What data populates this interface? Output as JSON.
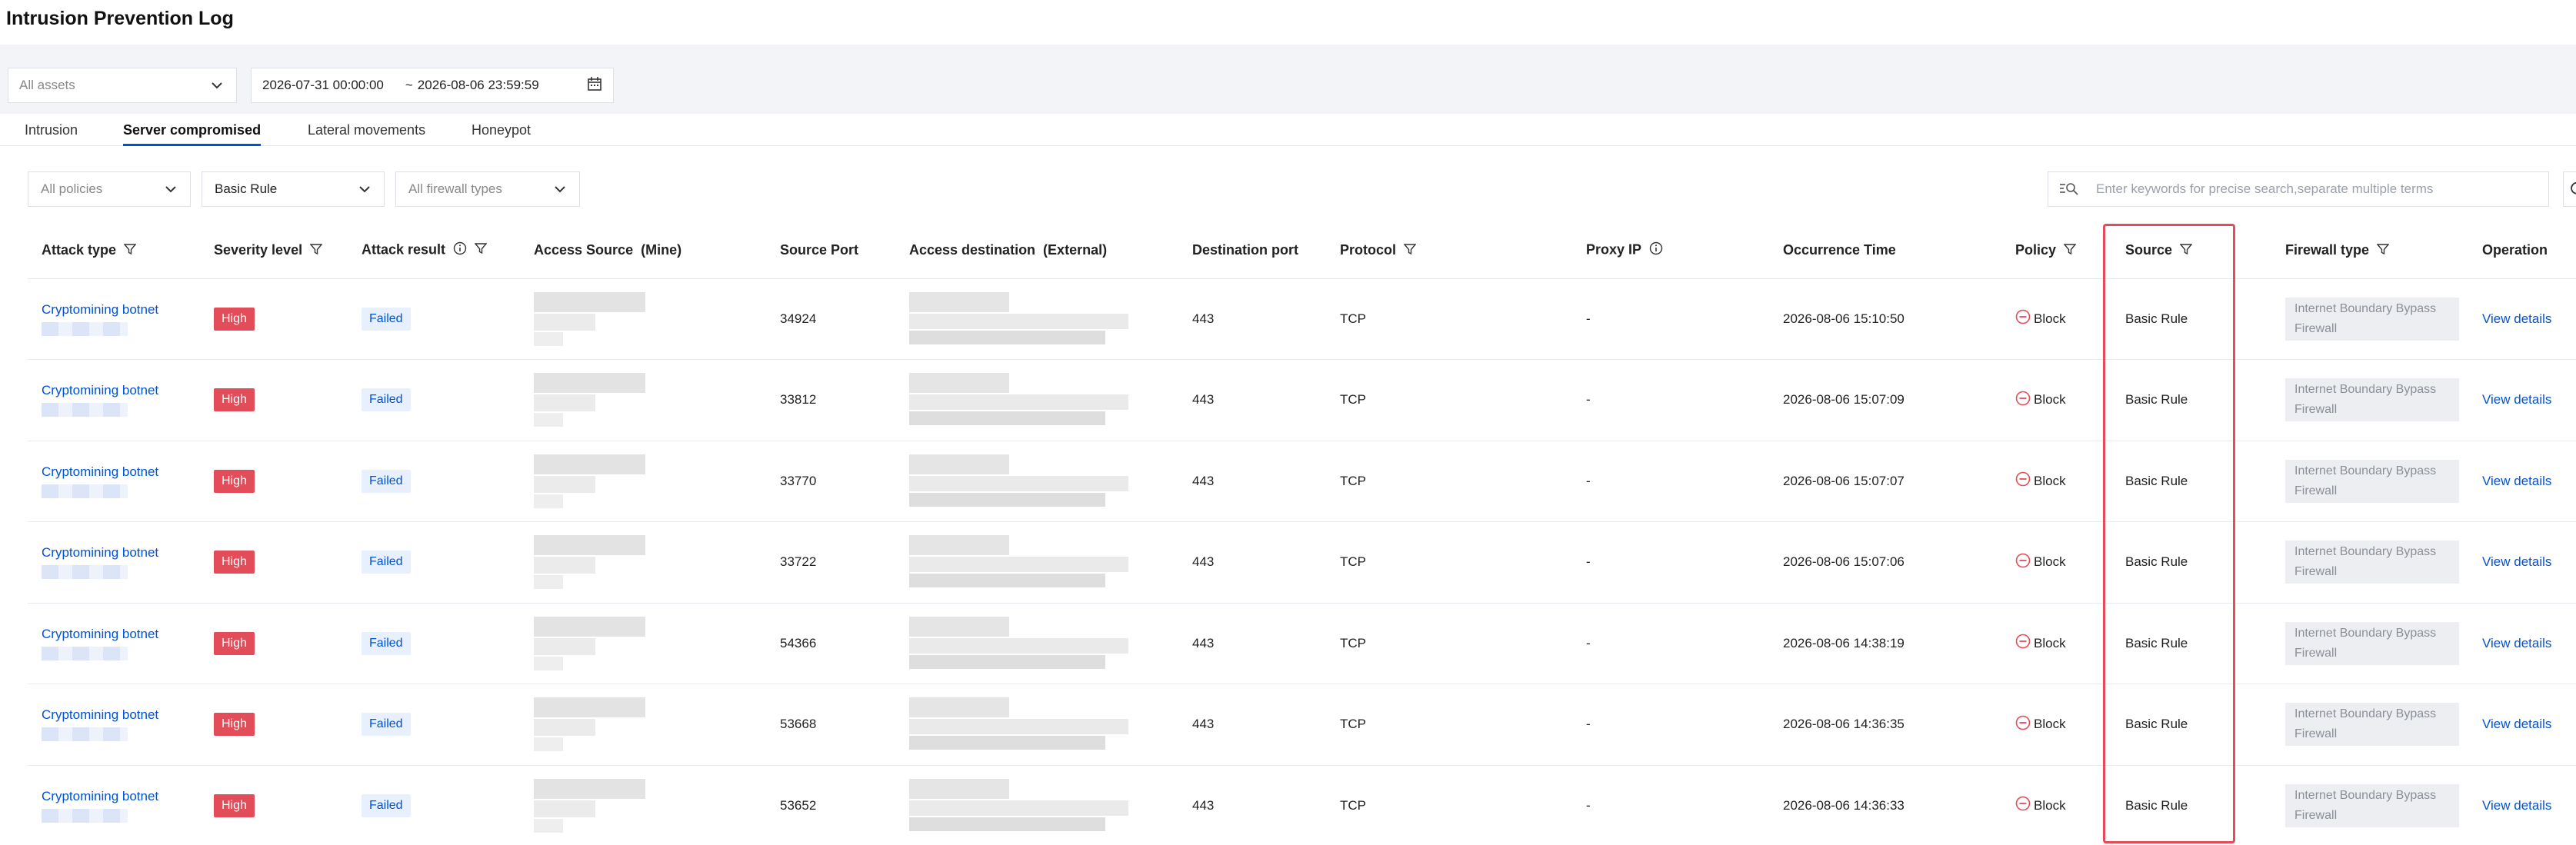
{
  "page": {
    "title": "Intrusion Prevention Log"
  },
  "toolbar": {
    "asset_select": "All assets",
    "date_start": "2026-07-31 00:00:00",
    "date_sep": "~",
    "date_end": "2026-08-06 23:59:59"
  },
  "tabs": [
    "Intrusion",
    "Server compromised",
    "Lateral movements",
    "Honeypot"
  ],
  "active_tab": "Server compromised",
  "filters": {
    "policy": "All policies",
    "rule": "Basic Rule",
    "firewall": "All firewall types",
    "search_placeholder": "Enter keywords for precise search,separate multiple terms"
  },
  "table": {
    "columns": [
      "Attack type",
      "Severity level",
      "Attack result",
      "Access Source  (Mine)",
      "Source Port",
      "Access destination  (External)",
      "Destination port",
      "Protocol",
      "Proxy IP",
      "Occurrence Time",
      "Policy",
      "Source",
      "Firewall type",
      "Operation"
    ],
    "rows": [
      {
        "attack_type": "Cryptomining botnet",
        "severity": "High",
        "result": "Failed",
        "source_port": "34924",
        "dest_port": "443",
        "protocol": "TCP",
        "proxy_ip": "-",
        "time": "2026-08-06 15:10:50",
        "policy": "Block",
        "source": "Basic Rule",
        "firewall_type": "Internet Boundary Bypass Firewall",
        "operation": "View details"
      },
      {
        "attack_type": "Cryptomining botnet",
        "severity": "High",
        "result": "Failed",
        "source_port": "33812",
        "dest_port": "443",
        "protocol": "TCP",
        "proxy_ip": "-",
        "time": "2026-08-06 15:07:09",
        "policy": "Block",
        "source": "Basic Rule",
        "firewall_type": "Internet Boundary Bypass Firewall",
        "operation": "View details"
      },
      {
        "attack_type": "Cryptomining botnet",
        "severity": "High",
        "result": "Failed",
        "source_port": "33770",
        "dest_port": "443",
        "protocol": "TCP",
        "proxy_ip": "-",
        "time": "2026-08-06 15:07:07",
        "policy": "Block",
        "source": "Basic Rule",
        "firewall_type": "Internet Boundary Bypass Firewall",
        "operation": "View details"
      },
      {
        "attack_type": "Cryptomining botnet",
        "severity": "High",
        "result": "Failed",
        "source_port": "33722",
        "dest_port": "443",
        "protocol": "TCP",
        "proxy_ip": "-",
        "time": "2026-08-06 15:07:06",
        "policy": "Block",
        "source": "Basic Rule",
        "firewall_type": "Internet Boundary Bypass Firewall",
        "operation": "View details"
      },
      {
        "attack_type": "Cryptomining botnet",
        "severity": "High",
        "result": "Failed",
        "source_port": "54366",
        "dest_port": "443",
        "protocol": "TCP",
        "proxy_ip": "-",
        "time": "2026-08-06 14:38:19",
        "policy": "Block",
        "source": "Basic Rule",
        "firewall_type": "Internet Boundary Bypass Firewall",
        "operation": "View details"
      },
      {
        "attack_type": "Cryptomining botnet",
        "severity": "High",
        "result": "Failed",
        "source_port": "53668",
        "dest_port": "443",
        "protocol": "TCP",
        "proxy_ip": "-",
        "time": "2026-08-06 14:36:35",
        "policy": "Block",
        "source": "Basic Rule",
        "firewall_type": "Internet Boundary Bypass Firewall",
        "operation": "View details"
      },
      {
        "attack_type": "Cryptomining botnet",
        "severity": "High",
        "result": "Failed",
        "source_port": "53652",
        "dest_port": "443",
        "protocol": "TCP",
        "proxy_ip": "-",
        "time": "2026-08-06 14:36:33",
        "policy": "Block",
        "source": "Basic Rule",
        "firewall_type": "Internet Boundary Bypass Firewall",
        "operation": "View details"
      }
    ]
  }
}
